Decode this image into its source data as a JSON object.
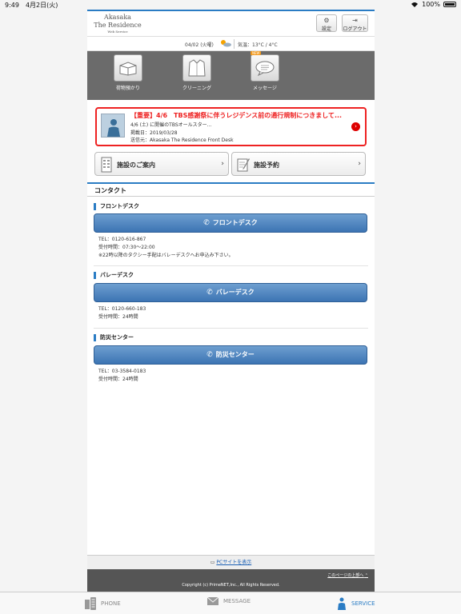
{
  "status_bar": {
    "time": "9:49",
    "date": "4月2日(火)",
    "battery": "100%"
  },
  "header": {
    "logo": {
      "line1": "Akasaka",
      "line2": "The Residence",
      "line3": "Web Service"
    },
    "settings_label": "設定",
    "logout_label": "ログアウト"
  },
  "info_bar": {
    "date": "04/02 (火曜)",
    "temperature": "気温：13°C / 4°C"
  },
  "menu": {
    "items": [
      {
        "label": "荷物預かり",
        "icon": "box-icon"
      },
      {
        "label": "クリーニング",
        "icon": "shirt-icon"
      },
      {
        "label": "メッセージ",
        "icon": "message-icon",
        "badge": "NEW"
      }
    ]
  },
  "notice": {
    "title": "【重要】4/6　TBS感謝祭に伴うレジデンス前の通行規制につきまして...",
    "subtitle": "4/6 (土) に開催のTBSオールスター...",
    "posted": "掲載日：2019/03/28",
    "sender": "送信元：Akasaka The Residence Front Desk"
  },
  "facility": {
    "guide_label": "施設のご案内",
    "booking_label": "施設予約"
  },
  "contact": {
    "title": "コンタクト",
    "sections": [
      {
        "heading": "フロントデスク",
        "button": "フロントデスク",
        "lines": [
          "TEL：0120-616-867",
          "受付時間：07:30〜22:00",
          "※22時以降のタクシー手配はバレーデスクへお申込み下さい。"
        ]
      },
      {
        "heading": "バレーデスク",
        "button": "バレーデスク",
        "lines": [
          "TEL：0120-660-183",
          "受付時間：24時間"
        ]
      },
      {
        "heading": "防災センター",
        "button": "防災センター",
        "lines": [
          "TEL：03-3584-0183",
          "受付時間：24時間"
        ]
      }
    ]
  },
  "footer": {
    "pc_link": "PCサイトを表示",
    "page_top": "このページの上部へ",
    "copyright": "Copyright (c) PrimeNET,Inc., All Rights Reserved."
  },
  "tabs": [
    {
      "label": "PHONE",
      "icon": "phone-icon"
    },
    {
      "label": "MESSAGE",
      "icon": "envelope-icon"
    },
    {
      "label": "SERVICE",
      "icon": "concierge-icon",
      "active": true
    }
  ],
  "colors": {
    "accent": "#2a7cc4",
    "alert": "#e22222",
    "menu_bg": "#6b6b6b",
    "footer_bg": "#555555"
  }
}
